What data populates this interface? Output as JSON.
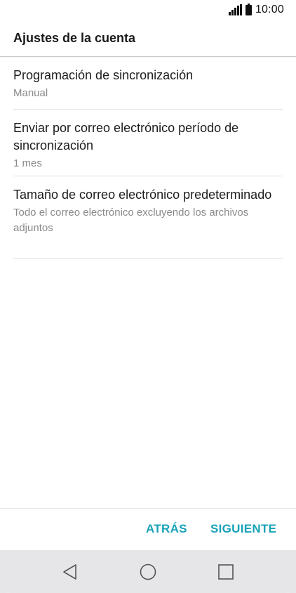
{
  "status_bar": {
    "time": "10:00",
    "icons": [
      "signal-icon",
      "battery-icon"
    ]
  },
  "header": {
    "title": "Ajustes de la cuenta"
  },
  "settings": {
    "items": [
      {
        "title": "Programación de sincronización",
        "value": "Manual"
      },
      {
        "title": "Enviar por correo electrónico período de sincronización",
        "value": "1 mes"
      },
      {
        "title": "Tamaño de correo electrónico predeterminado",
        "value": "Todo el correo electrónico excluyendo los archivos adjuntos"
      }
    ]
  },
  "footer": {
    "back_label": "ATRÁS",
    "next_label": "SIGUIENTE",
    "accent_color": "#17a2b8"
  },
  "nav_bar": {
    "icons": [
      "back-triangle-icon",
      "home-circle-icon",
      "recent-apps-square-icon"
    ]
  }
}
